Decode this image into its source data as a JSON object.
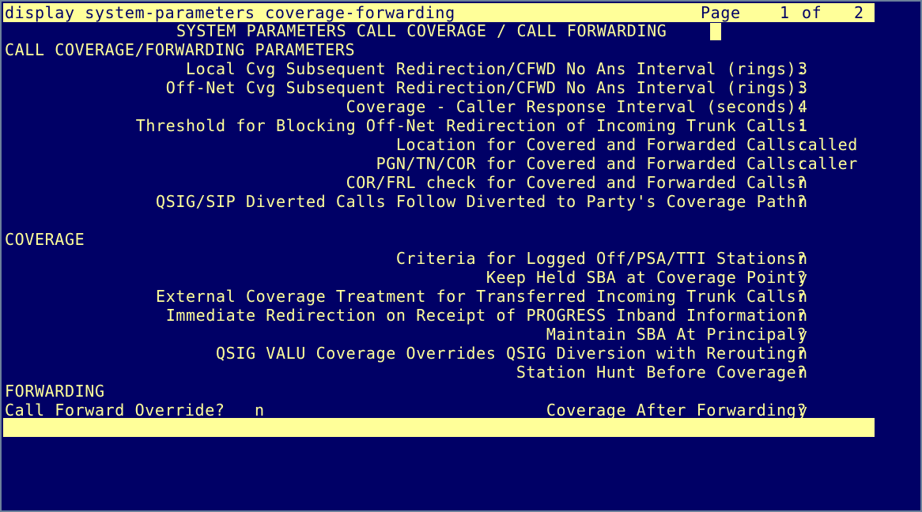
{
  "header": {
    "command": "display system-parameters coverage-forwarding",
    "page_label": "Page",
    "page_current": "1",
    "page_of": "of",
    "page_total": "2"
  },
  "title": "SYSTEM PARAMETERS CALL COVERAGE / CALL FORWARDING",
  "sections": {
    "call_coverage_forwarding": {
      "heading": "CALL COVERAGE/FORWARDING PARAMETERS",
      "fields": [
        {
          "label": "Local Cvg Subsequent Redirection/CFWD No Ans Interval (rings):",
          "value": "3"
        },
        {
          "label": "Off-Net Cvg Subsequent Redirection/CFWD No Ans Interval (rings):",
          "value": "3"
        },
        {
          "label": "Coverage - Caller Response Interval (seconds):",
          "value": "4"
        },
        {
          "label": "Threshold for Blocking Off-Net Redirection of Incoming Trunk Calls:",
          "value": "1"
        },
        {
          "label": "Location for Covered and Forwarded Calls:",
          "value": "called"
        },
        {
          "label": "PGN/TN/COR for Covered and Forwarded Calls:",
          "value": "caller"
        },
        {
          "label": "COR/FRL check for Covered and Forwarded Calls?",
          "value": "n"
        },
        {
          "label": "QSIG/SIP Diverted Calls Follow Diverted to Party's Coverage Path?",
          "value": "n"
        }
      ]
    },
    "coverage": {
      "heading": "COVERAGE",
      "fields": [
        {
          "label": "Criteria for Logged Off/PSA/TTI Stations?",
          "value": "n"
        },
        {
          "label": "Keep Held SBA at Coverage Point?",
          "value": "y"
        },
        {
          "label": "External Coverage Treatment for Transferred Incoming Trunk Calls?",
          "value": "n"
        },
        {
          "label": "Immediate Redirection on Receipt of PROGRESS Inband Information?",
          "value": "n"
        },
        {
          "label": "Maintain SBA At Principal?",
          "value": "y"
        },
        {
          "label": "QSIG VALU Coverage Overrides QSIG Diversion with Rerouting?",
          "value": "n"
        },
        {
          "label": "Station Hunt Before Coverage?",
          "value": "n"
        }
      ]
    },
    "forwarding": {
      "heading": "FORWARDING",
      "call_forward_override": {
        "label": "Call Forward Override?",
        "value": "n"
      },
      "coverage_after_forwarding": {
        "label": "Coverage After Forwarding?",
        "value": "y"
      }
    }
  },
  "colors": {
    "background": "#000066",
    "text": "#ffff99",
    "highlight_bar": "#ffff99"
  }
}
